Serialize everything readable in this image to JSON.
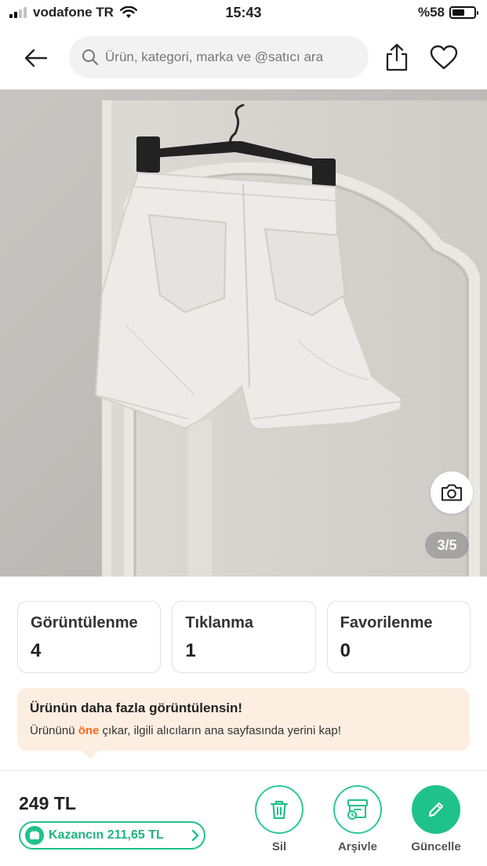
{
  "status_bar": {
    "carrier": "vodafone TR",
    "time": "15:43",
    "battery": "%58",
    "battery_level": 0.58,
    "signal_bars_active": 2
  },
  "header": {
    "search_placeholder": "Ürün, kategori, marka ve @satıcı ara",
    "icons": [
      "back-arrow-icon",
      "search-icon",
      "share-icon",
      "heart-icon"
    ]
  },
  "photo": {
    "counter": "3/5",
    "camera_icon": "camera-icon"
  },
  "stats": [
    {
      "label": "Görüntülenme",
      "value": "4"
    },
    {
      "label": "Tıklanma",
      "value": "1"
    },
    {
      "label": "Favorilenme",
      "value": "0"
    }
  ],
  "promo": {
    "title": "Ürünün daha fazla görüntülensin!",
    "text_before": "Ürününü ",
    "text_highlight": "öne",
    "text_after": " çıkar, ilgili alıcıların ana sayfasında yerini kap!"
  },
  "bottom": {
    "price": "249 TL",
    "earnings": "Kazancın 211,65 TL",
    "actions": [
      {
        "label": "Sil",
        "icon": "trash-icon"
      },
      {
        "label": "Arşivle",
        "icon": "archive-icon"
      },
      {
        "label": "Güncelle",
        "icon": "pencil-icon"
      }
    ]
  },
  "colors": {
    "accent_green": "#1fc28a",
    "promo_bg": "#fdeee2",
    "highlight_orange": "#ff6a1a"
  }
}
